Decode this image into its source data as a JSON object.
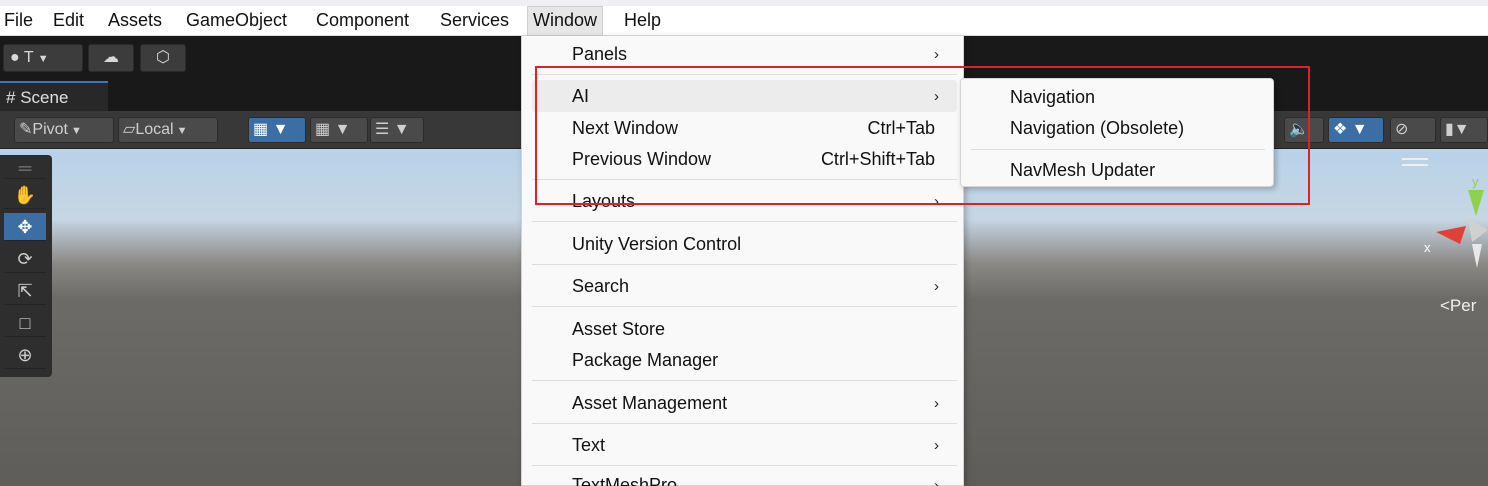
{
  "menubar": {
    "items": [
      "File",
      "Edit",
      "Assets",
      "GameObject",
      "Component",
      "Services",
      "Window",
      "Help"
    ]
  },
  "toolbar": {
    "account_label": "T",
    "scene_tab_label": "Scene",
    "pivot_label": "Pivot",
    "local_label": "Local"
  },
  "tools": [
    "hand",
    "move",
    "rotate",
    "scale",
    "rect",
    "transform"
  ],
  "gizmo": {
    "y_label": "y",
    "x_label": "x"
  },
  "persp_label": "<Per",
  "window_menu": {
    "items": [
      {
        "label": "Panels",
        "shortcut": "",
        "submenu": true
      },
      {
        "label": "AI",
        "shortcut": "",
        "submenu": true,
        "highlighted": true
      },
      {
        "label": "Next Window",
        "shortcut": "Ctrl+Tab",
        "submenu": false
      },
      {
        "label": "Previous Window",
        "shortcut": "Ctrl+Shift+Tab",
        "submenu": false
      },
      {
        "label": "Layouts",
        "shortcut": "",
        "submenu": true
      },
      {
        "label": "Unity Version Control",
        "shortcut": "",
        "submenu": false
      },
      {
        "label": "Search",
        "shortcut": "",
        "submenu": true
      },
      {
        "label": "Asset Store",
        "shortcut": "",
        "submenu": false
      },
      {
        "label": "Package Manager",
        "shortcut": "",
        "submenu": false
      },
      {
        "label": "Asset Management",
        "shortcut": "",
        "submenu": true
      },
      {
        "label": "Text",
        "shortcut": "",
        "submenu": true
      },
      {
        "label": "TextMeshPro",
        "shortcut": "",
        "submenu": true
      }
    ]
  },
  "ai_submenu": {
    "items": [
      "Navigation",
      "Navigation (Obsolete)",
      "NavMesh Updater"
    ]
  },
  "highlight_color": "#d8232a",
  "accent_color": "#3a6ea5"
}
